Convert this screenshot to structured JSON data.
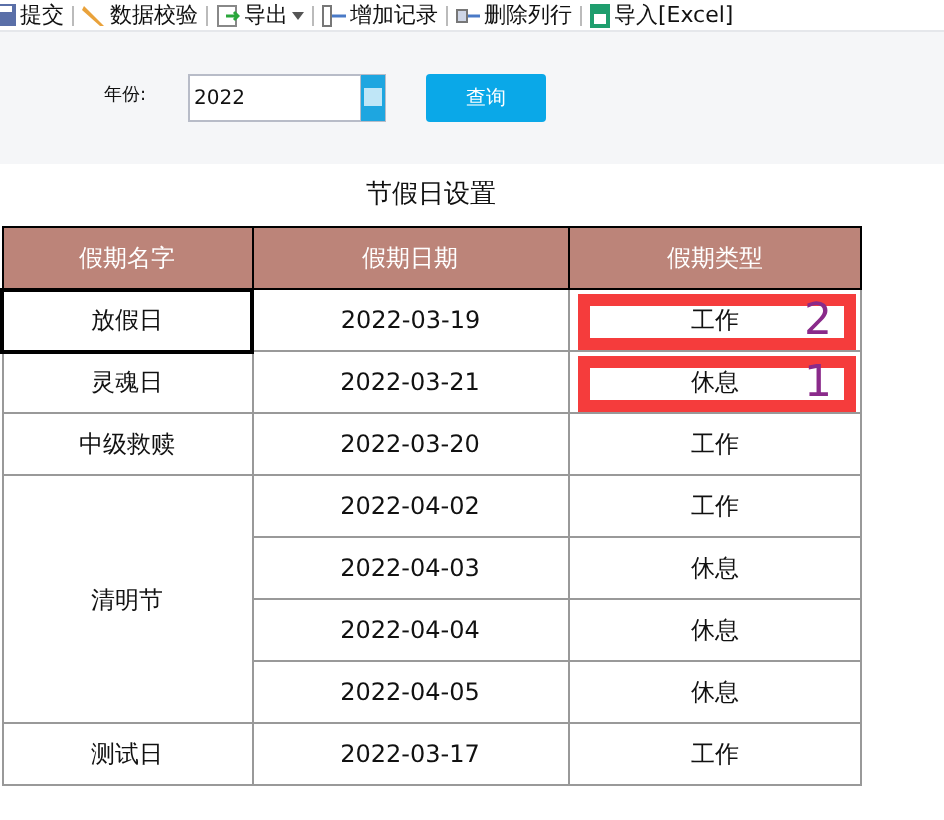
{
  "toolbar": [
    {
      "label": "提交",
      "has_menu": false
    },
    {
      "label": "数据校验",
      "has_menu": false
    },
    {
      "label": "导出",
      "has_menu": true
    },
    {
      "label": "增加记录",
      "has_menu": false
    },
    {
      "label": "删除列行",
      "has_menu": false
    },
    {
      "label": "导入[Excel]",
      "has_menu": false
    }
  ],
  "form": {
    "label": "年份:",
    "value": "2022",
    "button": "查询"
  },
  "table": {
    "title": "节假日设置",
    "columns": [
      "假期名字",
      "假期日期",
      "假期类型"
    ],
    "groups": [
      {
        "name": "放假日",
        "selected": true,
        "rows": [
          {
            "date": "2022-03-19",
            "type": "工作",
            "annotation": "2"
          }
        ]
      },
      {
        "name": "灵魂日",
        "selected": false,
        "rows": [
          {
            "date": "2022-03-21",
            "type": "休息",
            "annotation": "1"
          }
        ]
      },
      {
        "name": "中级救赎",
        "selected": false,
        "rows": [
          {
            "date": "2022-03-20",
            "type": "工作"
          }
        ]
      },
      {
        "name": "清明节",
        "selected": false,
        "rows": [
          {
            "date": "2022-04-02",
            "type": "工作"
          },
          {
            "date": "2022-04-03",
            "type": "休息"
          },
          {
            "date": "2022-04-04",
            "type": "休息"
          },
          {
            "date": "2022-04-05",
            "type": "休息"
          }
        ]
      },
      {
        "name": "测试日",
        "selected": false,
        "rows": [
          {
            "date": "2022-03-17",
            "type": "工作"
          }
        ]
      }
    ]
  }
}
